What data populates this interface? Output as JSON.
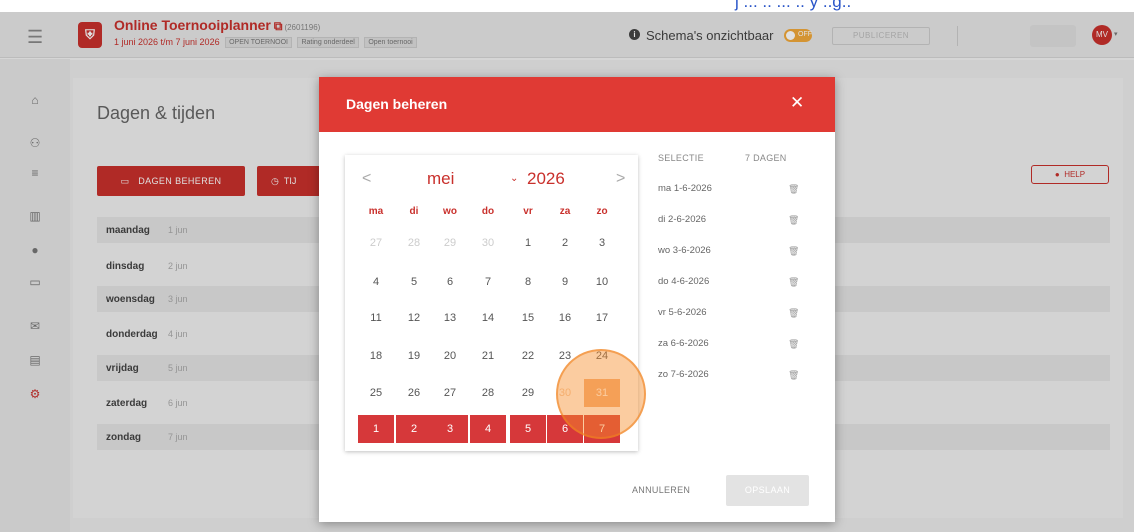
{
  "caption": {
    "text": "j ... .. ... .. y ..g.."
  },
  "header": {
    "menu_icon": "hamburger-icon",
    "logo_icon": "shield-icon",
    "title": "Online Toernooiplanner",
    "external_icon": "external-link-icon",
    "tournament_id": "(2601196)",
    "dates": "1 juni 2026 t/m 7 juni 2026",
    "badges": [
      "OPEN TOERNOOI",
      "Rating onderdeel",
      "Open toernooi"
    ],
    "schema_label": "Schema's onzichtbaar",
    "toggle_label": "OFF",
    "publish_label": "PUBLICEREN",
    "avatar_initials": "MV"
  },
  "sidebar": {
    "icons": [
      "home-icon",
      "people-icon",
      "list-icon",
      "chart-icon",
      "globe-icon",
      "monitor-icon",
      "mail-icon",
      "print-icon",
      "settings-icon"
    ]
  },
  "page": {
    "title": "Dagen & tijden",
    "dagen_button": "DAGEN BEHEREN",
    "tijd_button": "TIJ",
    "help_button": "HELP",
    "days": [
      {
        "name": "maandag",
        "date": "1 jun"
      },
      {
        "name": "dinsdag",
        "date": "2 jun"
      },
      {
        "name": "woensdag",
        "date": "3 jun"
      },
      {
        "name": "donderdag",
        "date": "4 jun"
      },
      {
        "name": "vrijdag",
        "date": "5 jun"
      },
      {
        "name": "zaterdag",
        "date": "6 jun"
      },
      {
        "name": "zondag",
        "date": "7 jun"
      }
    ]
  },
  "modal": {
    "title": "Dagen beheren",
    "close": "✕",
    "calendar": {
      "prev": "<",
      "next": ">",
      "month": "mei",
      "year_caret": "⌄",
      "year": "2026",
      "weekdays": [
        "ma",
        "di",
        "wo",
        "do",
        "vr",
        "za",
        "zo"
      ],
      "weeks": [
        [
          "27",
          "28",
          "29",
          "30",
          "1",
          "2",
          "3"
        ],
        [
          "4",
          "5",
          "6",
          "7",
          "8",
          "9",
          "10"
        ],
        [
          "11",
          "12",
          "13",
          "14",
          "15",
          "16",
          "17"
        ],
        [
          "18",
          "19",
          "20",
          "21",
          "22",
          "23",
          "24"
        ],
        [
          "25",
          "26",
          "27",
          "28",
          "29",
          "30",
          "31"
        ],
        [
          "1",
          "2",
          "3",
          "4",
          "5",
          "6",
          "7"
        ]
      ]
    },
    "selection": {
      "header_left": "SELECTIE",
      "header_right": "7 DAGEN",
      "items": [
        "ma 1-6-2026",
        "di 2-6-2026",
        "wo 3-6-2026",
        "do 4-6-2026",
        "vr 5-6-2026",
        "za 6-6-2026",
        "zo 7-6-2026"
      ]
    },
    "cancel": "ANNULEREN",
    "save": "OPSLAAN"
  }
}
